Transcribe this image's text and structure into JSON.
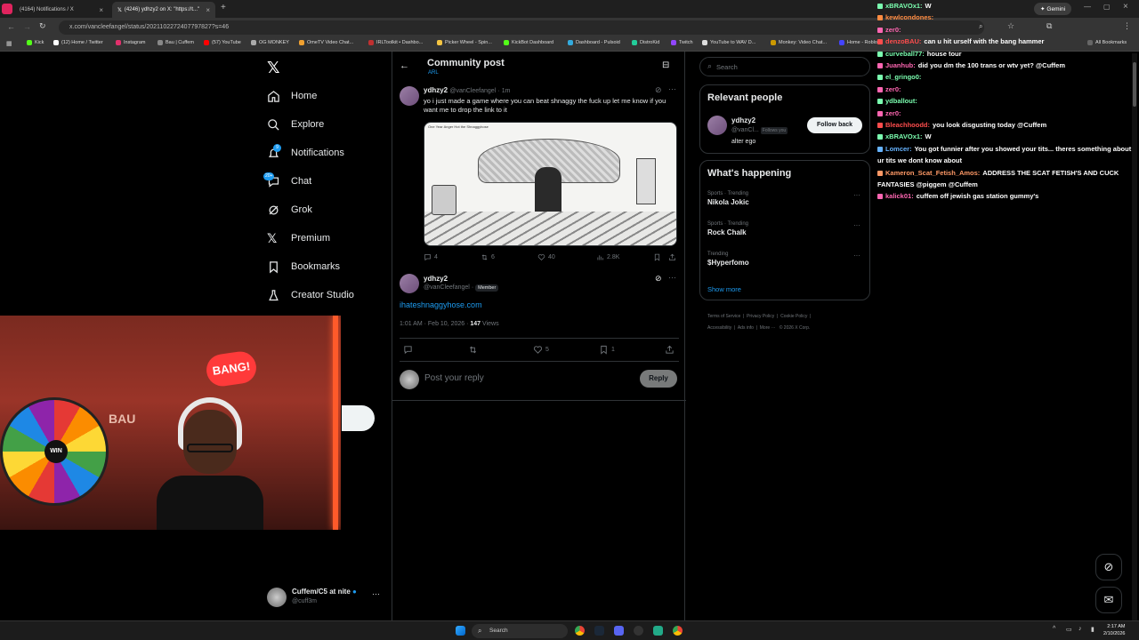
{
  "browser": {
    "tabs": [
      {
        "label": "(4164) Notifications / X"
      },
      {
        "label": "(4246) ydhzy2 on X: \"https://t...\""
      }
    ],
    "url": "x.com/vancleefangel/status/2021102272407797827?s=46",
    "profile_button": "Gemini",
    "bookmarks": [
      "Kick",
      "(12) Home / Twitter",
      "Instagram",
      "Bau | Cuffem",
      "(57) YouTube",
      "OG MONKEY",
      "OmeTV Video Chat...",
      "IRLToolkit • Dashbo...",
      "Picker Wheel - Spin...",
      "KickBot Dashboard",
      "Dashboard - Pulsoid",
      "DistroKid",
      "Twitch",
      "YouTube to WAV D...",
      "Monkey: Video Chat...",
      "Home - Roblox",
      "Bau | Cuffem",
      "All Bookmarks"
    ]
  },
  "nav": {
    "items": [
      "Home",
      "Explore",
      "Notifications",
      "Chat",
      "Grok",
      "Premium",
      "Bookmarks",
      "Creator Studio"
    ],
    "notif_badge": "9",
    "chat_badge": "20+"
  },
  "account": {
    "name": "Cuffem/C5 at nite",
    "handle": "@cuff3m"
  },
  "header": {
    "title": "Community post",
    "subtitle": "ARL"
  },
  "post": {
    "name": "ydhzy2",
    "handle": "@vanCleefangel",
    "time": "· 1m",
    "text": "yo i just made a game where you can beat shnaggy the fuck up let me know if you want me to drop the link to it",
    "image_caption": "One Year Anger Hot the Shnaggyhose",
    "stats": {
      "replies": "4",
      "reposts": "6",
      "likes": "40",
      "views": "2.8K"
    }
  },
  "reply": {
    "name": "ydhzy2",
    "handle": "@vanCleefangel",
    "badge": "Member",
    "link": "ihateshnaggyhose.com",
    "time": "1:01 AM · Feb 10, 2026 ·",
    "views_count": "147",
    "views_label": "Views",
    "likes": "5",
    "bookmarks": "1",
    "composer_placeholder": "Post your reply",
    "reply_button": "Reply"
  },
  "right": {
    "search_placeholder": "Search",
    "relevant": {
      "title": "Relevant people",
      "name": "ydhzy2",
      "handle": "@vanCl...",
      "follows_you": "Follows you",
      "bio": "alter ego",
      "button": "Follow back"
    },
    "happening": {
      "title": "What's happening",
      "trends": [
        {
          "context": "Sports · Trending",
          "name": "Nikola Jokic"
        },
        {
          "context": "Sports · Trending",
          "name": "Rock Chalk"
        },
        {
          "context": "Trending",
          "name": "$Hyperfomo"
        }
      ],
      "show_more": "Show more"
    },
    "footer": [
      "Terms of Service",
      "Privacy Policy",
      "Cookie Policy",
      "Accessibility",
      "Ads info",
      "More ···",
      "© 2026 X Corp."
    ]
  },
  "chat": [
    {
      "user": "xBRAVOx1:",
      "msg": "W",
      "color": "#7bffb0"
    },
    {
      "user": "kewlcondones:",
      "msg": "",
      "color": "#ff8c42"
    },
    {
      "user": "zer0:",
      "msg": "",
      "color": "#ff66b2"
    },
    {
      "user": "denzoBAU:",
      "msg": "can u hit urself with the bang hammer",
      "color": "#ff4d4d"
    },
    {
      "user": "curveball77:",
      "msg": "house tour",
      "color": "#7bffb0"
    },
    {
      "user": "Juanhub:",
      "msg": "did you dm the 100 trans or wtv yet? @Cuffem",
      "color": "#ff66b2"
    },
    {
      "user": "el_gringo0:",
      "msg": "",
      "color": "#7bffb0"
    },
    {
      "user": "zer0:",
      "msg": "",
      "color": "#ff66b2"
    },
    {
      "user": "ydballout:",
      "msg": "",
      "color": "#7bffb0"
    },
    {
      "user": "zer0:",
      "msg": "",
      "color": "#ff66b2"
    },
    {
      "user": "Bleachhoodd:",
      "msg": "you look disgusting today @Cuffem",
      "color": "#ff4d4d"
    },
    {
      "user": "xBRAVOx1:",
      "msg": "W",
      "color": "#7bffb0"
    },
    {
      "user": "Lomcer:",
      "msg": "You got funnier after you showed your tits... theres something about",
      "color": "#66b3ff"
    },
    {
      "user": "",
      "msg": "ur tits we dont know about",
      "color": "#fff"
    },
    {
      "user": "Kameron_Scat_Fetish_Amos:",
      "msg": "ADDRESS THE SCAT FETISH'S AND CUCK",
      "color": "#ff9966"
    },
    {
      "user": "",
      "msg": "FANTASIES @piggem @Cuffem",
      "color": "#fff"
    },
    {
      "user": "kalick01:",
      "msg": "cuffem off jewish gas station gummy's",
      "color": "#ff66b2"
    }
  ],
  "overlay": {
    "sign": "BANG!",
    "wall_text": "BAU",
    "wheel_label": "WIN"
  },
  "taskbar": {
    "search": "Search",
    "time": "2:17 AM",
    "date": "2/10/2026"
  }
}
